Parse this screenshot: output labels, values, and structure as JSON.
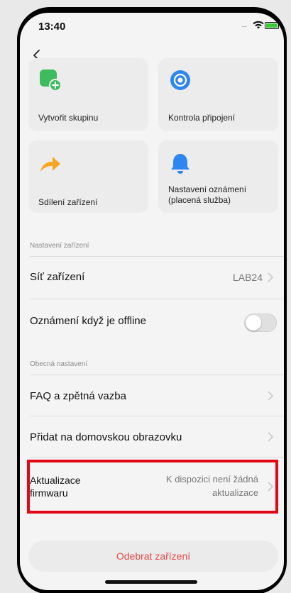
{
  "status_bar": {
    "time": "13:40",
    "signal": "....."
  },
  "cards": [
    {
      "label": "Vytvořit skupinu",
      "icon": "add-group-icon"
    },
    {
      "label": "Kontrola připojení",
      "icon": "connection-check-icon"
    },
    {
      "label": "Sdílení zařízení",
      "icon": "share-arrow-icon"
    },
    {
      "label_line1": "Nastavení oznámení",
      "label_line2": "(placená služba)",
      "icon": "bell-icon"
    }
  ],
  "device_settings": {
    "section_label": "Nastavení zařízení",
    "network": {
      "title": "Síť zařízení",
      "value": "LAB24"
    },
    "offline_notification": {
      "title": "Oznámení když je offline",
      "enabled": false
    }
  },
  "general_settings": {
    "section_label": "Obecná nastavení",
    "faq": {
      "title": "FAQ a zpětná vazba"
    },
    "home_screen": {
      "title": "Přidat na domovskou obrazovku"
    },
    "firmware": {
      "title_line1": "Aktualizace",
      "title_line2": "firmwaru",
      "value_line1": "K dispozici není žádná",
      "value_line2": "aktualizace"
    }
  },
  "remove_button": {
    "label": "Odebrat zařízení"
  },
  "colors": {
    "accent_red": "#e04a4a",
    "highlight_border": "#e30613",
    "green": "#3dbb5e",
    "blue": "#2f86f0",
    "orange": "#f5a623"
  }
}
